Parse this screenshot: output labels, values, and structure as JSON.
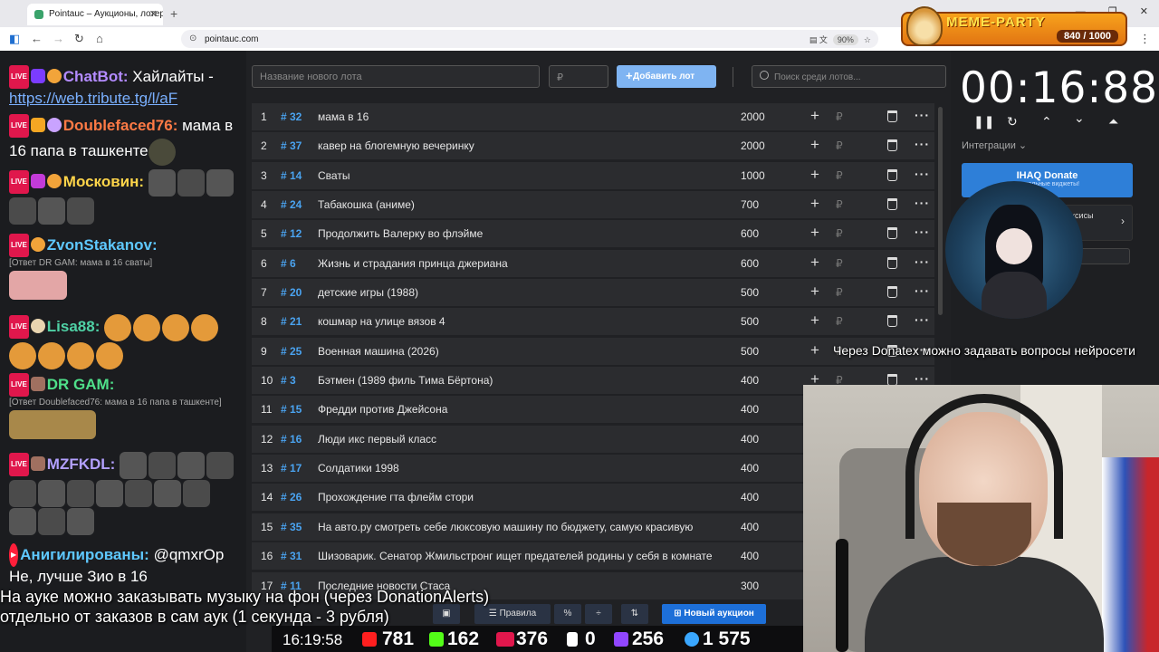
{
  "browser": {
    "tab_title": "Pointauc – Аукционы, лотереи",
    "url": "pointauc.com",
    "zoom": "90%"
  },
  "meme_party": {
    "title": "MEME-PARTY",
    "score": "840 / 1000"
  },
  "chat": [
    {
      "nick": "ChatBot:",
      "nick_color": "#b38bff",
      "text": "Хайлайты -",
      "link": "https://web.tribute.tg/l/aF"
    },
    {
      "nick": "Doublefaced76:",
      "nick_color": "#ff7a45",
      "text": "мама в 16 папа в ташкенте"
    },
    {
      "nick": "Московин:",
      "nick_color": "#ffd54a",
      "text": ""
    },
    {
      "nick": "ZvonStakanov:",
      "nick_color": "#5ec8ff",
      "reply": "[Ответ DR GAM: мама в 16 сваты]"
    },
    {
      "nick": "Lisa88:",
      "nick_color": "#4fd1a5",
      "text": ""
    },
    {
      "nick": "DR GAM:",
      "nick_color": "#4fe08a",
      "reply": "[Ответ Doublefaced76: мама в 16 папа в ташкенте]"
    },
    {
      "nick": "MZFKDL:",
      "nick_color": "#b3a0ff",
      "text": ""
    },
    {
      "nick": "Анигилированы:",
      "nick_color": "#5ec8ff",
      "text": "@qmxrOp",
      "text2": "Не, лучше Зио в 16"
    }
  ],
  "auction": {
    "name_placeholder": "Название нового лота",
    "sum_placeholder": "₽",
    "add_button": "Добавить лот",
    "search_placeholder": "Поиск среди лотов...",
    "rub": "₽",
    "lots": [
      {
        "n": "1",
        "id": "# 32",
        "name": "мама в 16",
        "amount": "2000"
      },
      {
        "n": "2",
        "id": "# 37",
        "name": "кавер на блогемную вечеринку",
        "amount": "2000"
      },
      {
        "n": "3",
        "id": "# 14",
        "name": "Сваты",
        "amount": "1000"
      },
      {
        "n": "4",
        "id": "# 24",
        "name": "Табакошка (аниме)",
        "amount": "700"
      },
      {
        "n": "5",
        "id": "# 12",
        "name": "Продолжить Валерку во флэйме",
        "amount": "600"
      },
      {
        "n": "6",
        "id": "# 6",
        "name": "Жизнь и страдания принца джериана",
        "amount": "600"
      },
      {
        "n": "7",
        "id": "# 20",
        "name": "детские игры (1988)",
        "amount": "500"
      },
      {
        "n": "8",
        "id": "# 21",
        "name": "кошмар на улице вязов 4",
        "amount": "500"
      },
      {
        "n": "9",
        "id": "# 25",
        "name": "Военная машина (2026)",
        "amount": "500"
      },
      {
        "n": "10",
        "id": "# 3",
        "name": "Бэтмен (1989 филь Тима Бёртона)",
        "amount": "400"
      },
      {
        "n": "11",
        "id": "# 15",
        "name": "Фредди против Джейсона",
        "amount": "400"
      },
      {
        "n": "12",
        "id": "# 16",
        "name": "Люди икс первый класс",
        "amount": "400"
      },
      {
        "n": "13",
        "id": "# 17",
        "name": "Солдатики 1998",
        "amount": "400"
      },
      {
        "n": "14",
        "id": "# 26",
        "name": "Прохождение гта флейм стори",
        "amount": "400"
      },
      {
        "n": "15",
        "id": "# 35",
        "name": "На авто.ру смотреть себе люксовую машину по бюджету, самую красивую",
        "amount": "400"
      },
      {
        "n": "16",
        "id": "# 31",
        "name": "Шизоварик. Сенатор Жмильстронг ищет предателей родины у себя в комнате",
        "amount": "400"
      },
      {
        "n": "17",
        "id": "# 11",
        "name": "Последние новости Стаса",
        "amount": "300"
      }
    ],
    "toolbar": {
      "rules": "Правила",
      "percent": "%",
      "new_auction": "Новый аукцион"
    }
  },
  "timer": {
    "value": "00:16:88",
    "integrations": "Интеграции"
  },
  "donate": {
    "title": "IHAQ Donate",
    "subtitle": "уникальные виджеты!",
    "panel_text": "ксисы"
  },
  "overlays": {
    "right": "Через Donatex можно задавать вопросы нейросети",
    "left_line1": "На ауке можно заказывать музыку на фон (через DonationAlerts)",
    "left_line2": "отдельно от заказов в сам аук (1 секунда - 3 рубля)"
  },
  "stats": {
    "time": "16:19:58",
    "youtube": "781",
    "kick": "162",
    "vk": "376",
    "rutube": "0",
    "twitch": "256",
    "total": "1 575"
  },
  "colors": {
    "accent": "#1d6fd8",
    "id_blue": "#4aa3f0",
    "live_red": "#e0174c"
  }
}
